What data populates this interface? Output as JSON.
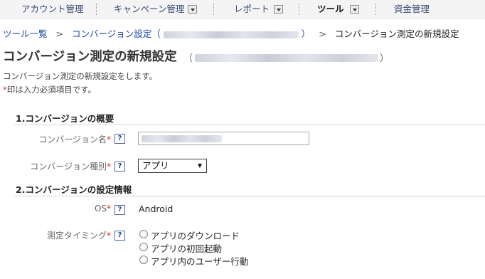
{
  "nav": {
    "items": [
      {
        "label": "アカウント管理"
      },
      {
        "label": "キャンペーン管理"
      },
      {
        "label": "レポート"
      },
      {
        "label": "ツール"
      },
      {
        "label": "資金管理"
      }
    ]
  },
  "breadcrumb": {
    "item1": "ツール一覧",
    "sep": ">",
    "item2_prefix": "コンバージョン設定（",
    "item2_suffix": "）",
    "current": "コンバージョン測定の新規設定"
  },
  "page": {
    "title": "コンバージョン測定の新規設定",
    "title_paren_open": "（",
    "title_paren_close": "）",
    "description": "コンバージョン測定の新規設定をします。",
    "required_mark": "*",
    "required_note": "印は入力必須項目です。"
  },
  "section1": {
    "title": "1.コンバージョンの概要",
    "name_label": "コンバージョン名",
    "type_label": "コンバージョン種別",
    "type_value": "アプリ"
  },
  "section2": {
    "title": "2.コンバージョンの設定情報",
    "os_label": "OS",
    "os_value": "Android",
    "timing_label": "測定タイミング",
    "timing_options": [
      {
        "label": "アプリのダウンロード"
      },
      {
        "label": "アプリの初回起動"
      },
      {
        "label": "アプリ内のユーザー行動"
      }
    ]
  },
  "help_icon_text": "?"
}
